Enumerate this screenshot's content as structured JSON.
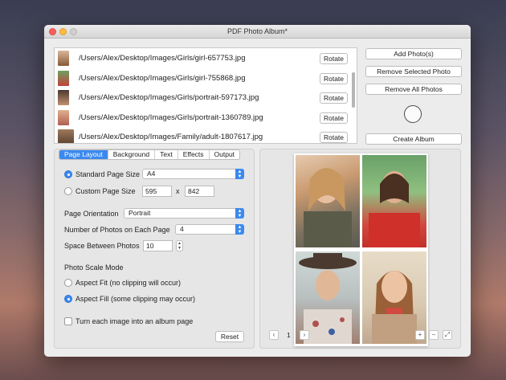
{
  "window": {
    "title": "PDF Photo Album*"
  },
  "files": [
    {
      "path": "/Users/Alex/Desktop/Images/Girls/girl-657753.jpg",
      "thumb": "#b08a6a"
    },
    {
      "path": "/Users/Alex/Desktop/Images/Girls/girl-755868.jpg",
      "thumb": "#c0443a"
    },
    {
      "path": "/Users/Alex/Desktop/Images/Girls/portrait-597173.jpg",
      "thumb": "#6a5040"
    },
    {
      "path": "/Users/Alex/Desktop/Images/Girls/portrait-1360789.jpg",
      "thumb": "#d09070"
    },
    {
      "path": "/Users/Alex/Desktop/Images/Family/adult-1807617.jpg",
      "thumb": "#8a6a50"
    }
  ],
  "rotate_label": "Rotate",
  "actions": {
    "add": "Add Photo(s)",
    "remove_selected": "Remove Selected Photo",
    "remove_all": "Remove All Photos",
    "create": "Create Album"
  },
  "tabs": [
    "Page Layout",
    "Background",
    "Text",
    "Effects",
    "Output"
  ],
  "layout": {
    "standard_label": "Standard Page Size",
    "standard_value": "A4",
    "custom_label": "Custom Page Size",
    "custom_width": "595",
    "custom_x": "x",
    "custom_height": "842",
    "orientation_label": "Page Orientation",
    "orientation_value": "Portrait",
    "photos_per_page_label": "Number of Photos on Each Page",
    "photos_per_page_value": "4",
    "spacing_label": "Space Between Photos",
    "spacing_value": "10",
    "scale_mode_label": "Photo Scale Mode",
    "aspect_fit_label": "Aspect Fit (no clipping will occur)",
    "aspect_fill_label": "Aspect Fill (some clipping may occur)",
    "album_page_label": "Turn each image into an album page",
    "reset_label": "Reset"
  },
  "preview": {
    "page_number": "1",
    "prev_icon": "‹",
    "next_icon": "›",
    "zoom_in_icon": "+",
    "zoom_out_icon": "−",
    "fullscreen_icon": "⤢"
  }
}
